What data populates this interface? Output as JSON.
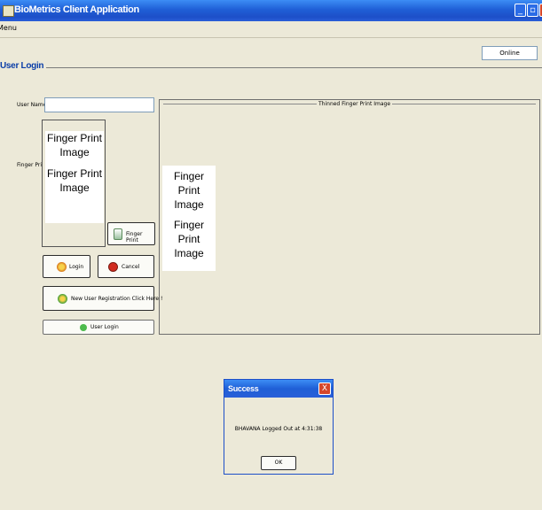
{
  "window": {
    "title": "BioMetrics Client Application"
  },
  "titlebar_buttons": {
    "minimize": "_",
    "maximize": "▫",
    "close": "X"
  },
  "menu": {
    "label": "Menu"
  },
  "status": {
    "label": "Online"
  },
  "login_frame": {
    "title": "User Login"
  },
  "form": {
    "username_label": "User Name:",
    "username_value": "",
    "fingerprint_label": "Finger Print:"
  },
  "fingerprint_image": {
    "line1": "Finger Print",
    "line2": "Image"
  },
  "buttons": {
    "finger_print": "Finger Print",
    "login": "Login",
    "cancel": "Cancel",
    "new_user": "New User Registration Click Here !",
    "user_login": "User Login"
  },
  "thinned_panel": {
    "title": "Thinned Finger Print Image"
  },
  "dialog": {
    "title": "Success",
    "close": "X",
    "message": "BHAVANA Logged Out at 4:31:38",
    "ok_label": "OK"
  },
  "colors": {
    "titlebar": "#1f5fd6",
    "window_bg": "#ece9d8",
    "close_button": "#d5462a",
    "legend_text": "#0b3ea8"
  }
}
